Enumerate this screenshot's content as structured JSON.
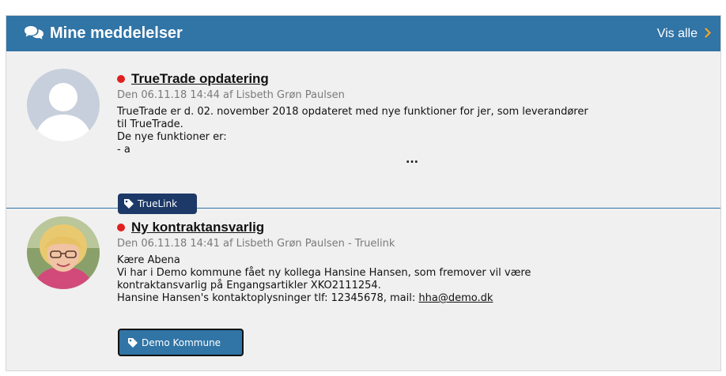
{
  "header": {
    "title": "Mine meddelelser",
    "show_all": "Vis alle",
    "icon": "chat-bubbles-icon",
    "chevron_icon": "chevron-right-icon",
    "accent_color": "#3174a6",
    "chevron_color": "#f5a623"
  },
  "messages": [
    {
      "title": "TrueTrade opdatering",
      "meta": "Den 06.11.18 14:44 af Lisbeth Grøn Paulsen",
      "body": [
        "TrueTrade er d. 02. november 2018 opdateret med nye funktioner for jer, som leverandører",
        "til TrueTrade.",
        "De nye funktioner er:",
        "- a"
      ],
      "more": "...",
      "tag": "TrueLink",
      "unread_color": "#e02020",
      "avatar": "default-person-avatar"
    },
    {
      "title": "Ny kontraktansvarlig",
      "meta": "Den 06.11.18 14:41 af Lisbeth Grøn Paulsen - Truelink",
      "body": [
        "Kære Abena",
        "Vi har i Demo kommune fået ny kollega Hansine Hansen, som fremover vil være",
        "kontraktansvarlig på Engangsartikler XKO2111254."
      ],
      "contact_prefix": "Hansine Hansen's kontaktoplysninger tlf: 12345678, mail: ",
      "email": "hha@demo.dk",
      "tag": "Demo Kommune",
      "unread_color": "#e02020",
      "avatar": "person-photo-avatar"
    }
  ]
}
